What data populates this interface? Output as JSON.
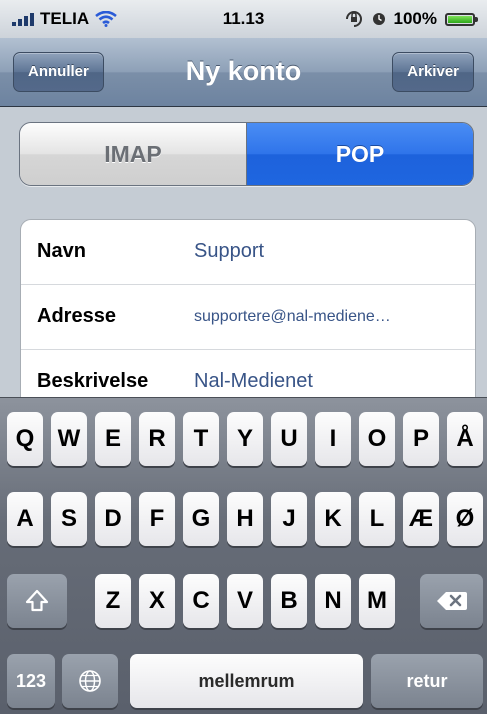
{
  "status_bar": {
    "carrier": "TELIA",
    "time": "11.13",
    "battery": "100%",
    "battery_level": 1.0
  },
  "nav": {
    "title": "Ny konto",
    "cancel_label": "Annuller",
    "save_label": "Arkiver"
  },
  "segment": {
    "options": [
      "IMAP",
      "POP"
    ],
    "selected": "POP"
  },
  "form": {
    "rows": [
      {
        "label": "Navn",
        "value": "Support"
      },
      {
        "label": "Adresse",
        "value": "supportere@nal-mediene…"
      },
      {
        "label": "Beskrivelse",
        "value": "Nal-Medienet"
      }
    ]
  },
  "keyboard": {
    "row1": [
      "Q",
      "W",
      "E",
      "R",
      "T",
      "Y",
      "U",
      "I",
      "O",
      "P",
      "Å"
    ],
    "row2": [
      "A",
      "S",
      "D",
      "F",
      "G",
      "H",
      "J",
      "K",
      "L",
      "Æ",
      "Ø"
    ],
    "row3": [
      "Z",
      "X",
      "C",
      "V",
      "B",
      "N",
      "M"
    ],
    "numbers_label": "123",
    "space_label": "mellemrum",
    "return_label": "retur"
  },
  "icons": [
    "signal-icon",
    "wifi-icon",
    "orientation-lock-icon",
    "alarm-icon",
    "battery-icon",
    "globe-icon",
    "shift-icon",
    "delete-icon"
  ]
}
